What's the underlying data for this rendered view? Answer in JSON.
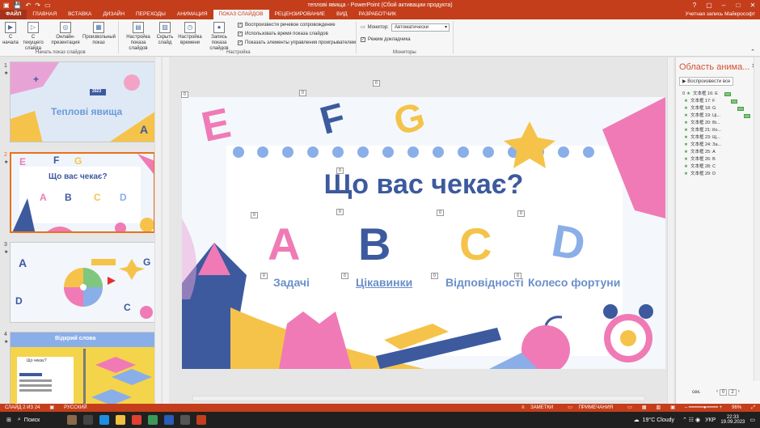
{
  "window": {
    "title": "теплові явища - PowerPoint (Сбой активации продукта)"
  },
  "tabs": [
    "ФАЙЛ",
    "ГЛАВНАЯ",
    "ВСТАВКА",
    "ДИЗАЙН",
    "ПЕРЕХОДЫ",
    "АНИМАЦИЯ",
    "ПОКАЗ СЛАЙДОВ",
    "РЕЦЕНЗИРОВАНИЕ",
    "ВИД",
    "РАЗРАБОТЧИК"
  ],
  "account": "Учетная запись Майкрософт",
  "ribbon": {
    "from_start": "С начала",
    "from_current": "С текущего слайда",
    "online": "Онлайн-презентация",
    "custom": "Произвольный показ",
    "group_start": "Начать показ слайдов",
    "setup": "Настройка показа слайдов",
    "hide": "Скрыть слайд",
    "rehearse": "Настройка времени",
    "record": "Запись показа слайдов",
    "chk_narration": "Воспроизвести речевое сопровождение",
    "chk_timings": "Использовать время показа слайдов",
    "chk_controls": "Показать элементы управления проигрывателем",
    "group_setup": "Настройка",
    "monitor_label": "Монитор:",
    "monitor_value": "Автоматически",
    "presenter": "Режим докладчика",
    "group_monitors": "Мониторы"
  },
  "thumbnails": [
    {
      "num": "1",
      "title": "Теплові явища",
      "year": "2023"
    },
    {
      "num": "2",
      "title": "Що вас чекає?"
    },
    {
      "num": "3",
      "title": ""
    },
    {
      "num": "4",
      "title": "Відкрий слова",
      "sub": "Що чекає?"
    }
  ],
  "slide": {
    "title": "Що вас чекає?",
    "letters": [
      "A",
      "B",
      "C",
      "D"
    ],
    "labels": [
      "Задачі",
      "Цікавинки",
      "Відповідності",
      "Колесо фортуни"
    ],
    "deco_letters": [
      "E",
      "F",
      "G"
    ],
    "tags": [
      "0",
      "0",
      "0",
      "0",
      "0",
      "0",
      "0",
      "0",
      "0",
      "0",
      "0",
      "0",
      "0",
      "0",
      "0"
    ]
  },
  "animation_pane": {
    "title": "Область анима...",
    "play_all": "Воспроизвести все",
    "items": [
      {
        "num": "0",
        "label": "文本框 16: E"
      },
      {
        "num": "",
        "label": "文本框 17: F"
      },
      {
        "num": "",
        "label": "文本框 18: G"
      },
      {
        "num": "",
        "label": "文本框 19: Ці..."
      },
      {
        "num": "",
        "label": "文本框 20: Ві..."
      },
      {
        "num": "",
        "label": "文本框 21: Ко..."
      },
      {
        "num": "",
        "label": "文本框 23: Щ..."
      },
      {
        "num": "",
        "label": "文本框 24: За..."
      },
      {
        "num": "",
        "label": "文本框 25: A"
      },
      {
        "num": "",
        "label": "文本框 26: B"
      },
      {
        "num": "",
        "label": "文本框 28: C"
      },
      {
        "num": "",
        "label": "文本框 29: D"
      }
    ],
    "sec_label": "сек.",
    "page_value": "0",
    "page_total": "2"
  },
  "status": {
    "slide": "СЛАЙД 2 ИЗ 24",
    "lang": "РУССКИЙ",
    "notes": "ЗАМЕТКИ",
    "comments": "ПРИМЕЧАНИЯ",
    "zoom": "96%"
  },
  "taskbar": {
    "search": "Поиск",
    "weather": "19°C Cloudy",
    "lang": "УКР",
    "time": "22:33",
    "date": "19.09.2023"
  }
}
